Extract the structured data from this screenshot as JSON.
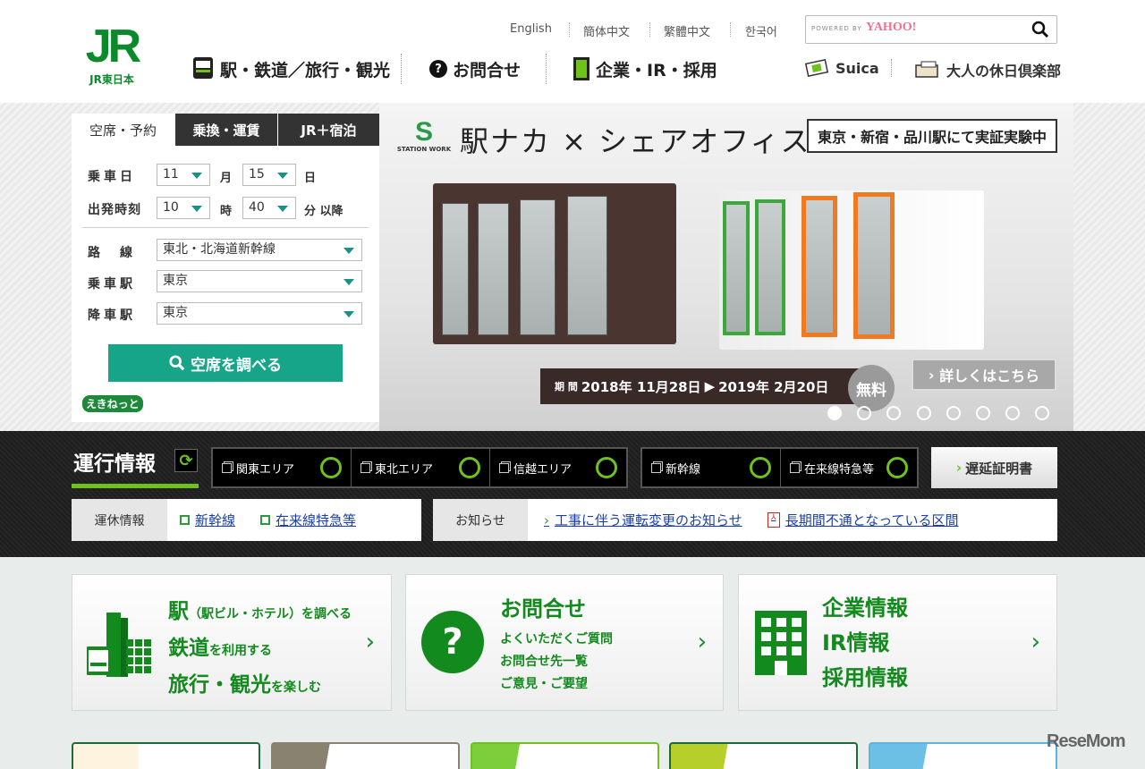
{
  "header": {
    "logo_text": "JR",
    "logo_sub": "JR東日本",
    "languages": [
      "English",
      "簡体中文",
      "繁體中文",
      "한국어"
    ],
    "search": {
      "powered_by": "POWERED BY",
      "provider": "YAHOO!"
    },
    "nav": [
      {
        "label": "駅・鉄道／旅行・観光",
        "icon": "train-icon"
      },
      {
        "label": "お問合せ",
        "icon": "question-icon"
      },
      {
        "label": "企業・IR・採用",
        "icon": "building-icon"
      }
    ],
    "sub_nav": [
      {
        "label": "Suica",
        "icon": "suica-card-icon"
      },
      {
        "label": "大人の休日倶楽部",
        "icon": "club-card-icon"
      }
    ]
  },
  "booking": {
    "tabs": [
      "空席・予約",
      "乗換・運賃",
      "JR＋宿泊"
    ],
    "date_label": "乗車日",
    "month": "11",
    "month_unit": "月",
    "day": "15",
    "day_unit": "日",
    "time_label": "出発時刻",
    "hour": "10",
    "hour_unit": "時",
    "minute": "40",
    "minute_unit": "分 以降",
    "line_label": "路線",
    "line": "東北・北海道新幹線",
    "from_label": "乗車駅",
    "from": "東京",
    "to_label": "降車駅",
    "to": "東京",
    "search_button": "空席を調べる",
    "ekinet": "えきねっと"
  },
  "banner": {
    "logo_s": "S",
    "logo_text": "STATION WORK",
    "title": "駅ナカ × シェアオフィス",
    "box": "東京・新宿・品川駅にて実証実験中",
    "period_label": "期 間",
    "period_start": "2018年 11月28日",
    "period_end": "2019年 2月20日",
    "free": "無料",
    "more": "詳しくはこちら",
    "slides": 8,
    "active_slide": 1
  },
  "status": {
    "title": "運行情報",
    "areas": [
      [
        "関東エリア",
        "東北エリア",
        "信越エリア"
      ],
      [
        "新幹線",
        "在来線特急等"
      ]
    ],
    "status_color": "#6fc21c",
    "delay_cert": "遅延証明書",
    "suspension_label": "運休情報",
    "suspension_links": [
      "新幹線",
      "在来線特急等"
    ],
    "notice_label": "お知らせ",
    "notice_links": [
      "工事に伴う運転変更のお知らせ",
      "長期間不通となっている区間"
    ]
  },
  "cards": [
    {
      "lines": [
        {
          "big": "駅",
          "small": "（駅ビル・ホテル）を調べる"
        },
        {
          "big": "鉄道",
          "small": "を利用する"
        },
        {
          "big": "旅行・観光",
          "small": "を楽しむ"
        }
      ]
    },
    {
      "title": "お問合せ",
      "items": [
        "よくいただくご質問",
        "お問合せ先一覧",
        "ご意見・ご要望"
      ]
    },
    {
      "items": [
        "企業情報",
        "IR情報",
        "採用情報"
      ]
    }
  ],
  "watermark": "ReseMom",
  "colors": {
    "brand": "#0a8a2a",
    "teal": "#17a58a",
    "link": "#1a3fa8"
  }
}
